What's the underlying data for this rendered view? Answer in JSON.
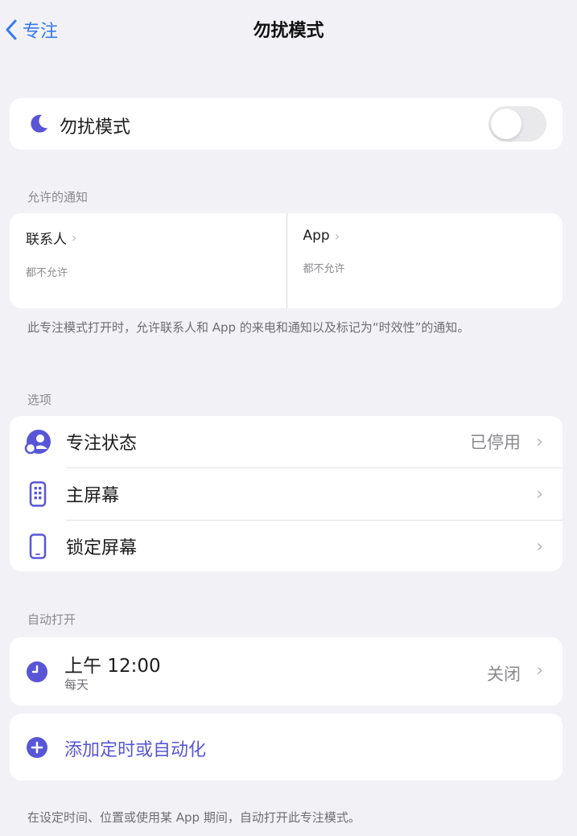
{
  "nav": {
    "back_label": "专注",
    "title": "勿扰模式"
  },
  "focus_toggle": {
    "label": "勿扰模式",
    "enabled": false
  },
  "allowed_notifications": {
    "header": "允许的通知",
    "people": {
      "title": "联系人",
      "subtitle": "都不允许"
    },
    "apps": {
      "title": "App",
      "subtitle": "都不允许"
    },
    "footer": "此专注模式打开时，允许联系人和 App 的来电和通知以及标记为“时效性”的通知。"
  },
  "options": {
    "header": "选项",
    "items": [
      {
        "label": "专注状态",
        "value": "已停用",
        "icon": "person-circle-icon"
      },
      {
        "label": "主屏幕",
        "value": "",
        "icon": "home-screen-icon"
      },
      {
        "label": "锁定屏幕",
        "value": "",
        "icon": "lock-screen-icon"
      }
    ]
  },
  "auto_on": {
    "header": "自动打开",
    "schedule": {
      "title": "上午 12:00",
      "subtitle": "每天",
      "value": "关闭",
      "icon": "clock-icon"
    },
    "add_label": "添加定时或自动化",
    "footer": "在设定时间、位置或使用某 App 期间，自动打开此专注模式。"
  },
  "colors": {
    "accent": "#5856d6",
    "link": "#3478f6",
    "background": "#f2f2f6"
  }
}
